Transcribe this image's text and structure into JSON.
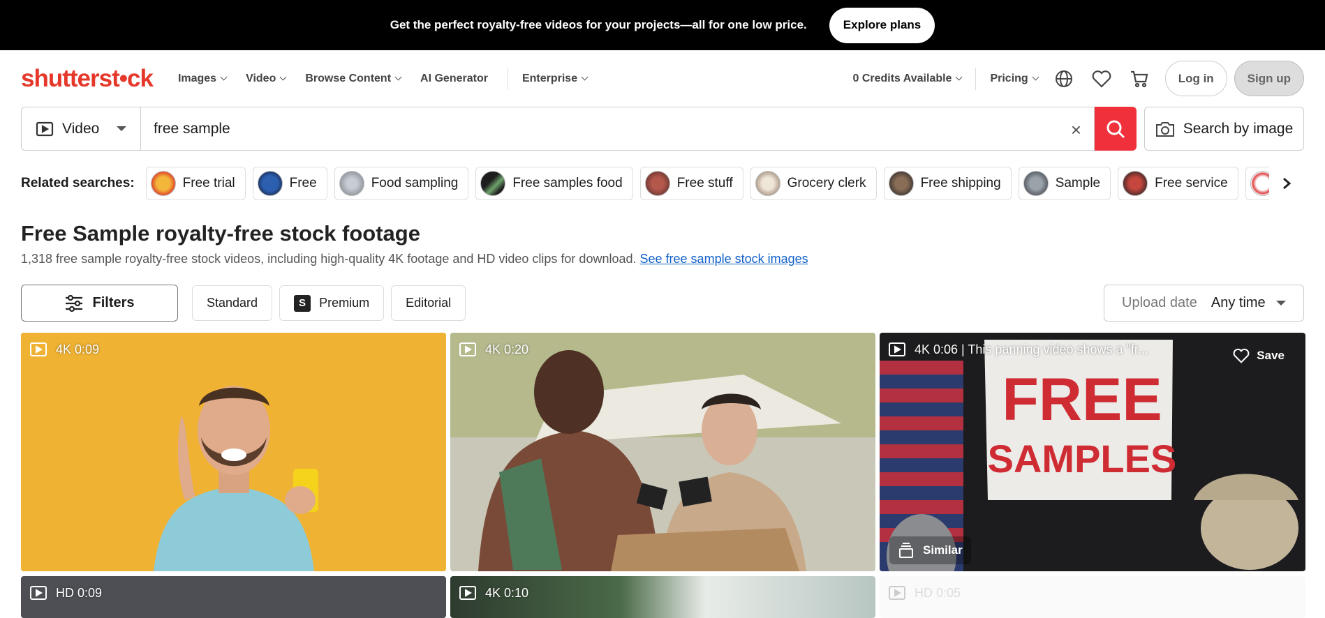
{
  "promo": {
    "text": "Get the perfect royalty-free videos for your projects—all for one low price.",
    "button": "Explore plans"
  },
  "nav": {
    "logo": "shutterst•ck",
    "links": [
      "Images",
      "Video",
      "Browse Content",
      "AI Generator",
      "Enterprise"
    ],
    "credits": "0 Credits Available",
    "pricing": "Pricing",
    "login": "Log in",
    "signup": "Sign up",
    "icons": [
      "globe-icon",
      "heart-icon",
      "cart-icon"
    ]
  },
  "search": {
    "type": "Video",
    "query": "free sample",
    "by_image": "Search by image"
  },
  "related": {
    "label": "Related searches:",
    "items": [
      "Free trial",
      "Free",
      "Food sampling",
      "Free samples food",
      "Free stuff",
      "Grocery clerk",
      "Free shipping",
      "Sample",
      "Free service"
    ]
  },
  "results": {
    "title": "Free Sample royalty-free stock footage",
    "subtitle": "1,318 free sample royalty-free stock videos, including high-quality 4K footage and HD video clips for download.",
    "link": "See free sample stock images"
  },
  "filters": {
    "button": "Filters",
    "tags": [
      "Standard",
      "Premium",
      "Editorial"
    ],
    "upload_label": "Upload date",
    "upload_value": "Any time"
  },
  "videos": [
    {
      "badge": "4K 0:09"
    },
    {
      "badge": "4K 0:20"
    },
    {
      "badge": "4K 0:06 | This panning video shows a \"fr...",
      "save": "Save",
      "similar": "Similar",
      "sign": "FREE SAMPLES"
    },
    {
      "badge": "HD 0:09"
    },
    {
      "badge": "4K 0:10"
    },
    {
      "badge": "HD 0:05"
    }
  ],
  "colors": {
    "brand": "#e5372a",
    "search_button": "#f0303a",
    "link": "#1060c8"
  }
}
